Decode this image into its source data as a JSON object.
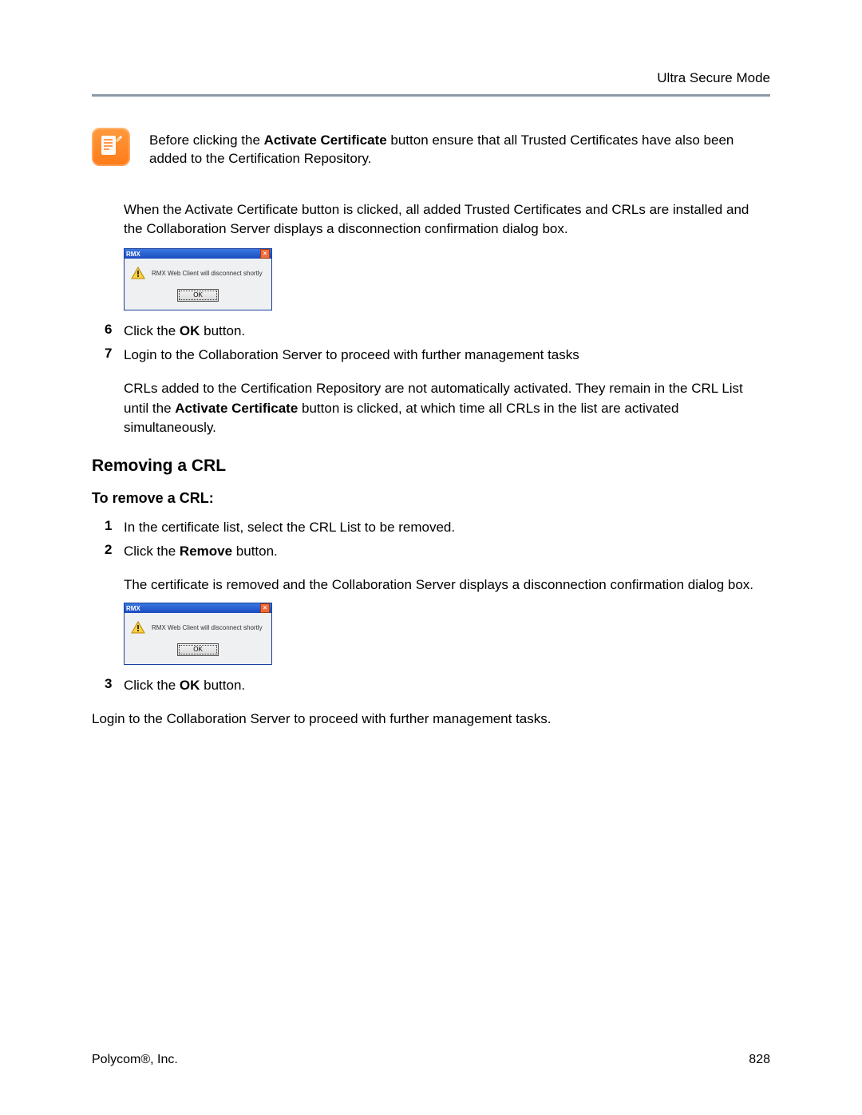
{
  "header": {
    "section_title": "Ultra Secure Mode"
  },
  "note": {
    "pre": "Before clicking the ",
    "bold": "Activate Certificate",
    "post": " button ensure that all Trusted Certificates have also been added to the Certification Repository."
  },
  "intro_paragraph": "When the Activate Certificate button is clicked, all added Trusted Certificates and CRLs are installed and the Collaboration Server displays a disconnection confirmation dialog box.",
  "dialogs": {
    "title": "RMX",
    "message": "RMX Web Client will disconnect shortly",
    "ok_label": "OK"
  },
  "steps_a": {
    "s6": {
      "num": "6",
      "pre": "Click the ",
      "bold": "OK",
      "post": " button."
    },
    "s7": {
      "num": "7",
      "text": "Login to the Collaboration Server to proceed with further management tasks",
      "follow_pre": "CRLs added to the Certification Repository are not automatically activated. They remain in the CRL List until the ",
      "follow_bold": "Activate Certificate",
      "follow_post": " button is clicked, at which time all CRLs in the list are activated simultaneously."
    }
  },
  "section_heading": "Removing a CRL",
  "subheading": "To remove a CRL:",
  "steps_b": {
    "s1": {
      "num": "1",
      "text": "In the certificate list, select the CRL List to be removed."
    },
    "s2": {
      "num": "2",
      "pre": "Click the ",
      "bold": "Remove",
      "post": " button.",
      "follow": "The certificate is removed and the Collaboration Server displays a disconnection confirmation dialog box."
    },
    "s3": {
      "num": "3",
      "pre": "Click the ",
      "bold": "OK",
      "post": " button."
    }
  },
  "closing_line": "Login to the Collaboration Server to proceed with further management tasks.",
  "footer": {
    "left_pre": "Polycom",
    "registered": "®",
    "left_post": ", Inc.",
    "page": "828"
  }
}
